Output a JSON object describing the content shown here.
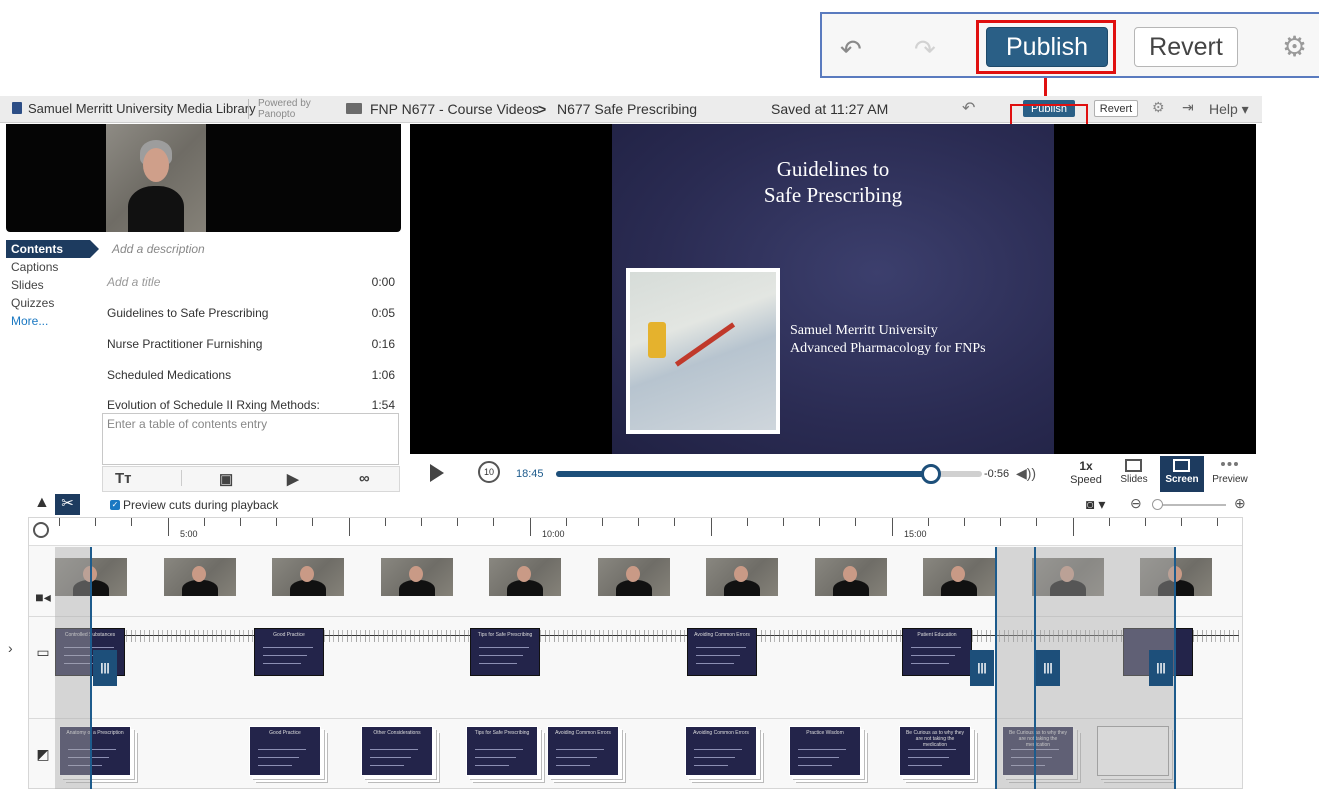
{
  "callout": {
    "publish_label": "Publish",
    "revert_label": "Revert",
    "undo_icon": "undo-icon",
    "redo_icon": "redo-icon",
    "gear_icon": "gear-icon",
    "highlight_color": "#e01010"
  },
  "header": {
    "org_name": "Samuel Merritt University Media Library",
    "powered_line1": "Powered by",
    "powered_line2": "Panopto",
    "breadcrumb_folder": "FNP N677 - Course Videos",
    "breadcrumb_separator": ">",
    "breadcrumb_session": "N677 Safe Prescribing",
    "saved_status": "Saved at 11:27 AM",
    "publish_label": "Publish",
    "revert_label": "Revert",
    "help_label": "Help",
    "accent_color": "#2a5f86"
  },
  "nav": {
    "items": [
      {
        "label": "Contents",
        "active": true
      },
      {
        "label": "Captions"
      },
      {
        "label": "Slides"
      },
      {
        "label": "Quizzes"
      },
      {
        "label": "More..."
      }
    ]
  },
  "contents": {
    "description_placeholder": "Add a description",
    "entries": [
      {
        "title": "Add a title",
        "time": "0:00"
      },
      {
        "title": "Guidelines to Safe Prescribing",
        "time": "0:05"
      },
      {
        "title": "Nurse Practitioner Furnishing",
        "time": "0:16"
      },
      {
        "title": "Scheduled Medications",
        "time": "1:06"
      },
      {
        "title": "Evolution of Schedule II Rxing Methods:",
        "time": "1:54"
      }
    ],
    "entry_placeholder": "Enter a table of contents entry",
    "tools": [
      "text-format-icon",
      "quiz-icon",
      "youtube-icon",
      "link-icon"
    ]
  },
  "slide": {
    "title_line1": "Guidelines to",
    "title_line2": "Safe Prescribing",
    "subtitle_line1": "Samuel Merritt University",
    "subtitle_line2": "Advanced Pharmacology for FNPs"
  },
  "player": {
    "current_time": "18:45",
    "remaining_time": "-0:56",
    "progress": 0.88,
    "rewind_label": "10",
    "speed_value": "1x",
    "speed_label": "Speed",
    "mode_slides": "Slides",
    "mode_screen": "Screen",
    "mode_preview": "Preview"
  },
  "editor": {
    "preview_cuts_label": "Preview cuts during playback",
    "preview_cuts_checked": true
  },
  "timeline": {
    "tick_labels": [
      "5:00",
      "10:00",
      "15:00"
    ],
    "screen_slides": [
      {
        "title": "Controlled Substances"
      },
      {
        "title": "Good Practice"
      },
      {
        "title": "Tips for Safe Prescribing"
      },
      {
        "title": "Avoiding Common Errors"
      },
      {
        "title": "Patient Education"
      }
    ],
    "slide_cards": [
      {
        "title": "Anatomy of a Prescription"
      },
      {
        "title": "Good Practice"
      },
      {
        "title": "Other Considerations"
      },
      {
        "title": "Tips for Safe Prescribing"
      },
      {
        "title": "Avoiding Common Errors"
      },
      {
        "title": "Avoiding Common Errors"
      },
      {
        "title": "Practice Wisdom"
      },
      {
        "title": "Be Curious as to why they are not taking the medication"
      },
      {
        "title": "Be Curious as to why they are not taking the medication"
      }
    ]
  }
}
